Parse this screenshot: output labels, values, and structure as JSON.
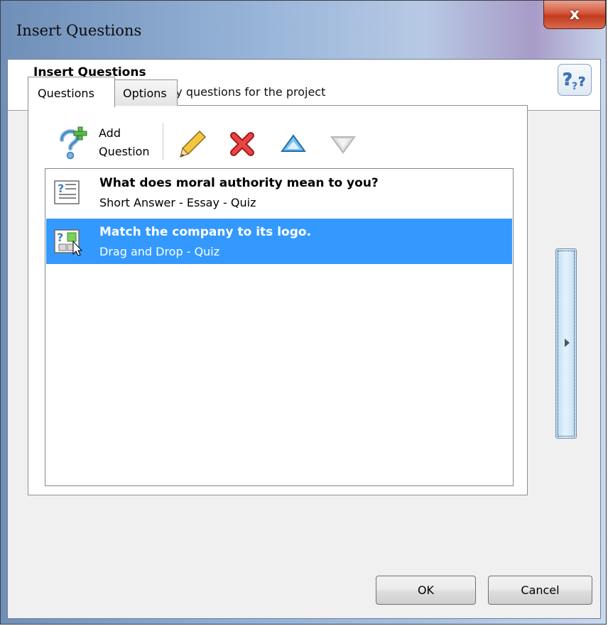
{
  "window": {
    "title": "Insert Questions",
    "close_glyph": "x"
  },
  "header": {
    "title": "Insert Questions",
    "subtitle": "Create scored or survey questions for the project",
    "help_icon": "help-question-icon"
  },
  "tabs": [
    {
      "label": "Questions",
      "active": true
    },
    {
      "label": "Options",
      "active": false
    }
  ],
  "toolbar": {
    "add_line1": "Add",
    "add_line2": "Question",
    "icons": [
      "add-question-icon",
      "edit-pencil-icon",
      "delete-x-icon",
      "move-up-icon",
      "move-down-icon"
    ]
  },
  "questions": [
    {
      "title": "What does moral authority mean to you?",
      "subtitle": "Short Answer - Essay - Quiz",
      "icon": "short-answer-icon",
      "selected": false
    },
    {
      "title": "Match the company to its logo.",
      "subtitle": "Drag and Drop - Quiz",
      "icon": "drag-drop-icon",
      "selected": true
    }
  ],
  "buttons": {
    "ok": "OK",
    "cancel": "Cancel"
  },
  "colors": {
    "selection": "#3399ff",
    "close": "#c33b1f"
  }
}
